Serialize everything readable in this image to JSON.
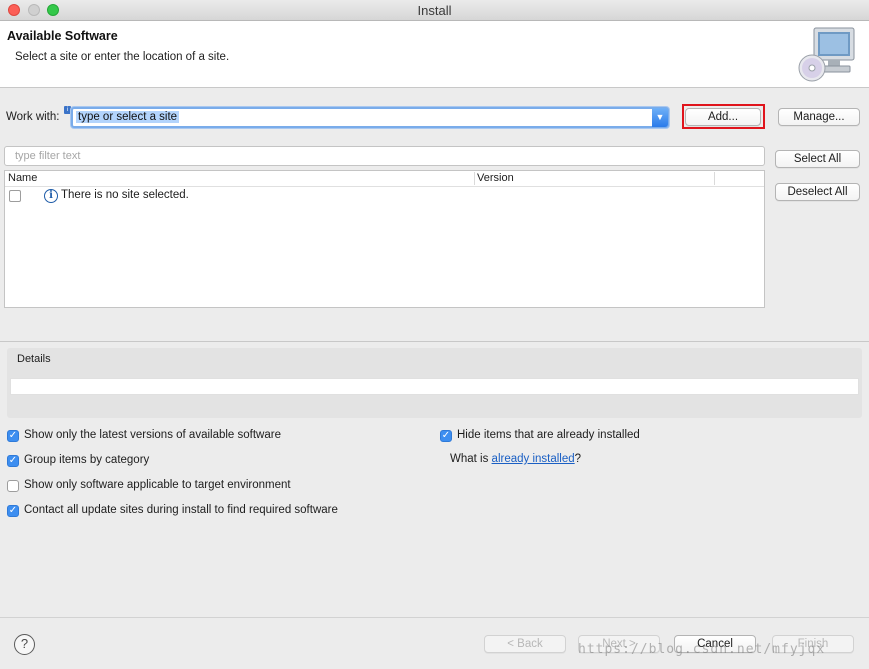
{
  "window": {
    "title": "Install"
  },
  "banner": {
    "title": "Available Software",
    "subtitle": "Select a site or enter the location of a site."
  },
  "work_with": {
    "label": "Work with:",
    "value": "type or select a site",
    "add_label": "Add...",
    "manage_label": "Manage..."
  },
  "filter": {
    "placeholder": "type filter text"
  },
  "side_buttons": {
    "select_all": "Select All",
    "deselect_all": "Deselect All"
  },
  "table": {
    "columns": [
      "Name",
      "Version"
    ],
    "message": "There is no site selected."
  },
  "details": {
    "label": "Details"
  },
  "options": {
    "left": [
      {
        "label": "Show only the latest versions of available software",
        "checked": true
      },
      {
        "label": "Group items by category",
        "checked": true
      },
      {
        "label": "Show only software applicable to target environment",
        "checked": false
      },
      {
        "label": "Contact all update sites during install to find required software",
        "checked": true
      }
    ],
    "hide_installed": {
      "label": "Hide items that are already installed",
      "checked": true
    },
    "what_is_prefix": "What is ",
    "what_is_link": "already installed",
    "what_is_suffix": "?"
  },
  "footer": {
    "back": "< Back",
    "next": "Next >",
    "cancel": "Cancel",
    "finish": "Finish",
    "help_icon": "?"
  },
  "watermark": "https://blog.csdn.net/mfyjqx",
  "colors": {
    "accent": "#3d8ef0",
    "highlight": "#e0141c",
    "link": "#1a5fc4"
  }
}
